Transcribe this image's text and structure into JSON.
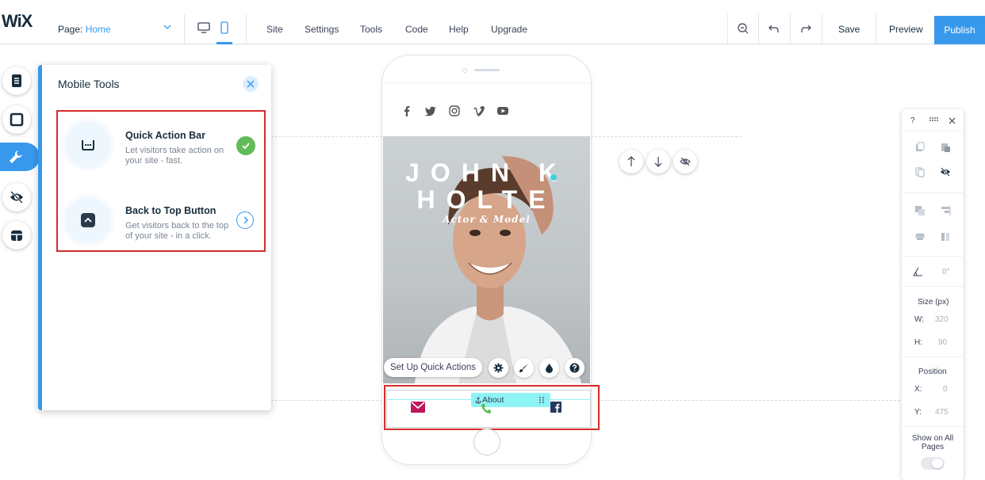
{
  "topbar": {
    "logo": "WiX",
    "page_label": "Page:",
    "page_value": "Home",
    "menu": [
      "Site",
      "Settings",
      "Tools",
      "Code",
      "Help",
      "Upgrade"
    ],
    "save": "Save",
    "preview": "Preview",
    "publish": "Publish"
  },
  "panel": {
    "title": "Mobile Tools",
    "tools": [
      {
        "title": "Quick Action Bar",
        "desc": "Let visitors take action on your site - fast.",
        "status": "enabled"
      },
      {
        "title": "Back to Top Button",
        "desc": "Get visitors back to the top of your site - in a click.",
        "status": "available"
      }
    ]
  },
  "phone": {
    "hero_line1": "JOHN K",
    "hero_line2": "HOLTE",
    "hero_sub": "Actor & Model",
    "quick_actions_button": "Set Up Quick Actions",
    "about_tag": "About"
  },
  "inspector": {
    "help": "?",
    "angle": "0°",
    "size_label": "Size (px)",
    "w_label": "W:",
    "w_value": "320",
    "h_label": "H:",
    "h_value": "90",
    "position_label": "Position",
    "x_label": "X:",
    "x_value": "0",
    "y_label": "Y:",
    "y_value": "475",
    "show_all_pages": "Show on All Pages"
  },
  "colors": {
    "accent": "#3899ec",
    "highlight": "#d62b2b",
    "check": "#60bc57",
    "about_tag": "#8ef3f7"
  }
}
